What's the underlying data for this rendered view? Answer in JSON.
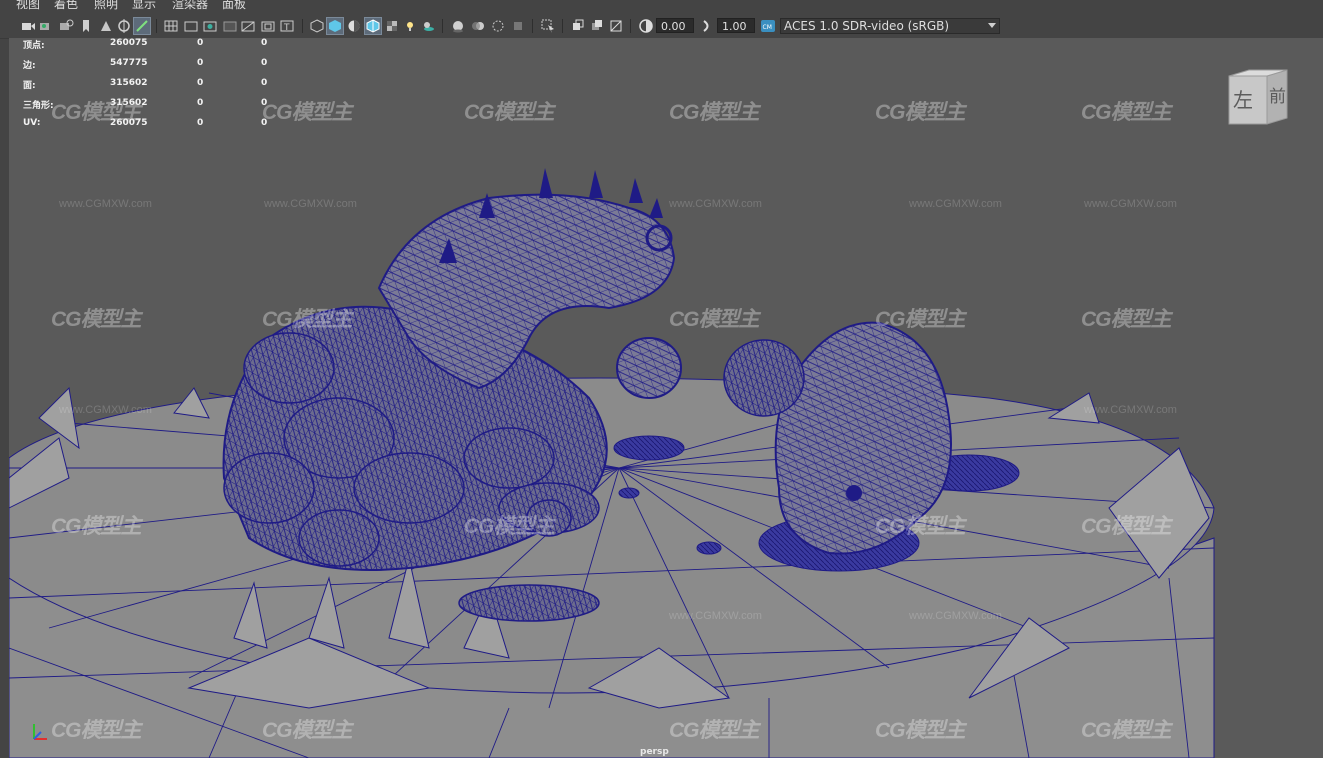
{
  "menu": [
    "视图",
    "着色",
    "照明",
    "显示",
    "渲染器",
    "面板"
  ],
  "toolbar": {
    "exposure_value": "0.00",
    "gamma_value": "1.00",
    "color_space": "ACES 1.0 SDR-video (sRGB)",
    "icons": [
      "select-camera-icon",
      "camera-attributes-icon",
      "bookmark-icon",
      "image-plane-icon",
      "two-d-pan-icon",
      "grease-pencil-icon",
      "grid-icon",
      "film-gate-icon",
      "resolution-gate-icon",
      "gate-mask-icon",
      "field-chart-icon",
      "safe-action-icon",
      "safe-title-icon",
      "wireframe-icon",
      "smooth-shade-icon",
      "default-material-icon",
      "wireframe-on-shaded-icon",
      "xray-icon",
      "use-lights-icon",
      "shadows-icon",
      "screen-space-ao-icon",
      "motion-blur-icon",
      "anti-alias-icon",
      "isolate-select-icon",
      "xray-joints-icon",
      "xray-active-icon",
      "backface-cull-icon",
      "exposure-icon",
      "gamma-icon",
      "color-management-icon"
    ]
  },
  "hud": {
    "rows": [
      {
        "label": "顶点:",
        "v1": "260075",
        "v2": "0",
        "v3": "0"
      },
      {
        "label": "边:",
        "v1": "547775",
        "v2": "0",
        "v3": "0"
      },
      {
        "label": "面:",
        "v1": "315602",
        "v2": "0",
        "v3": "0"
      },
      {
        "label": "三角形:",
        "v1": "315602",
        "v2": "0",
        "v3": "0"
      },
      {
        "label": "UV:",
        "v1": "260075",
        "v2": "0",
        "v3": "0"
      }
    ]
  },
  "viewcube": {
    "left_face": "左",
    "front_face": "前"
  },
  "camera_label": "persp",
  "watermark": {
    "text": "CG模型主",
    "url": "www.CGMXW.com"
  },
  "colors": {
    "wire": "#1f1b86",
    "ground": "#8a8a8a",
    "viewport_bg": "#5a5a5a",
    "active_tool": "#5d6b7a"
  }
}
